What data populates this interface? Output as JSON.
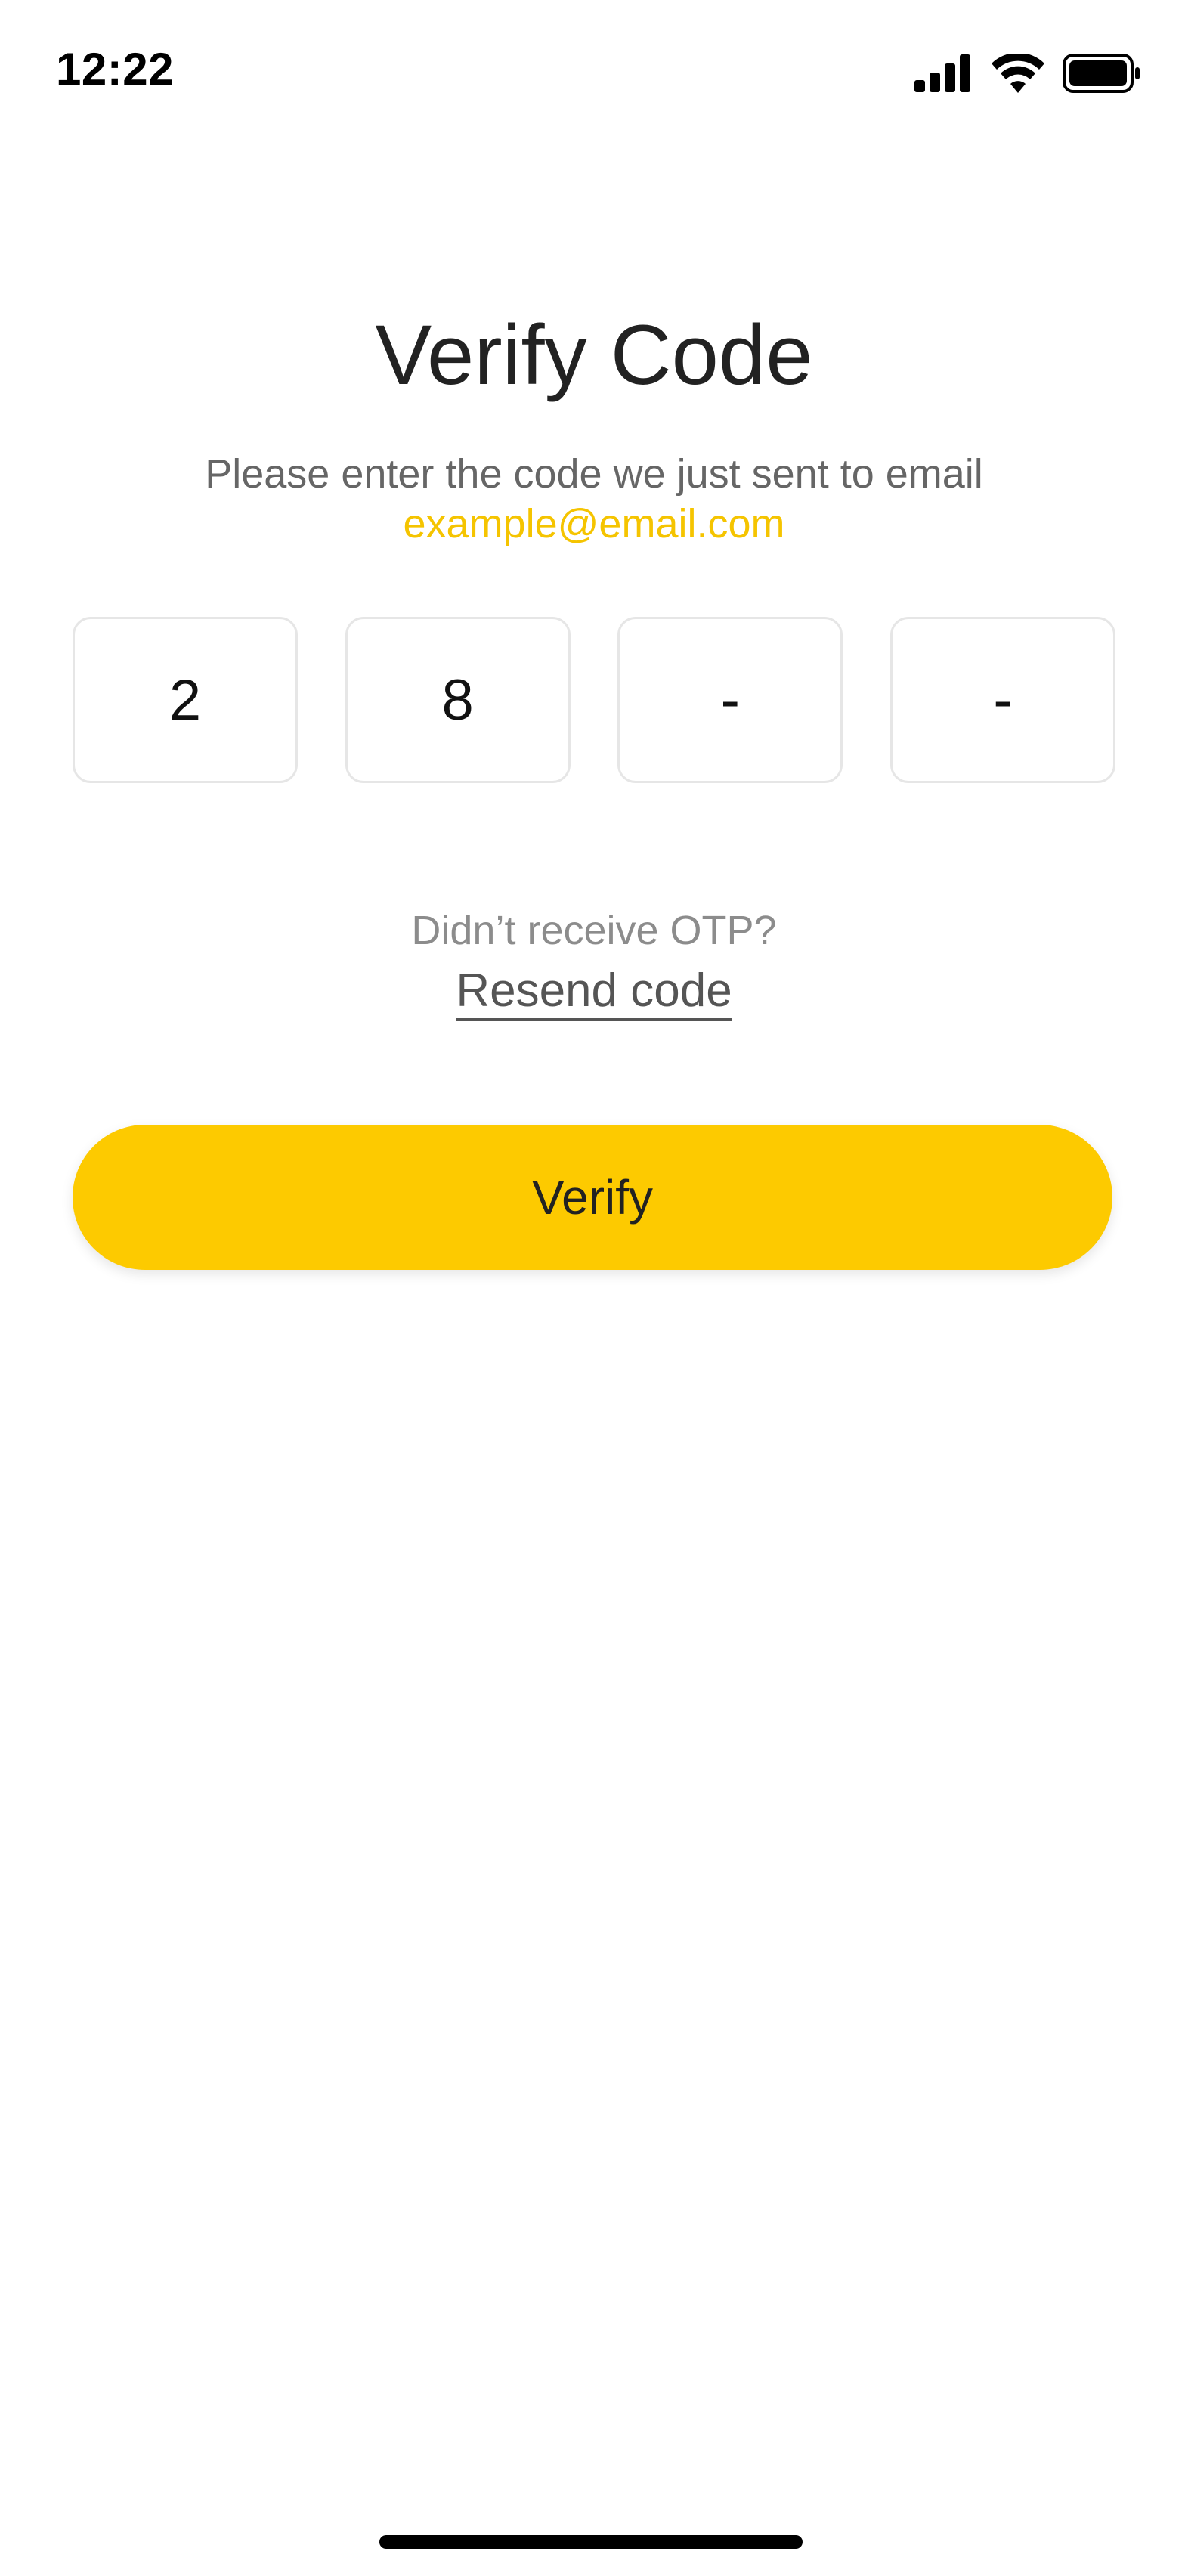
{
  "status_bar": {
    "time": "12:22",
    "icons": [
      "signal-icon",
      "wifi-icon",
      "battery-icon"
    ]
  },
  "screen": {
    "title": "Verify Code",
    "subtitle": "Please enter the code we just sent to email",
    "email": "example@email.com"
  },
  "otp": {
    "digits": [
      "2",
      "8",
      "-",
      "-"
    ]
  },
  "resend": {
    "prompt": "Didn’t receive OTP?",
    "link_label": "Resend code"
  },
  "actions": {
    "verify_label": "Verify"
  },
  "colors": {
    "accent": "#FDCA00",
    "email_text": "#F5C400",
    "title_text": "#222222",
    "muted_text": "#8C8C8C"
  }
}
